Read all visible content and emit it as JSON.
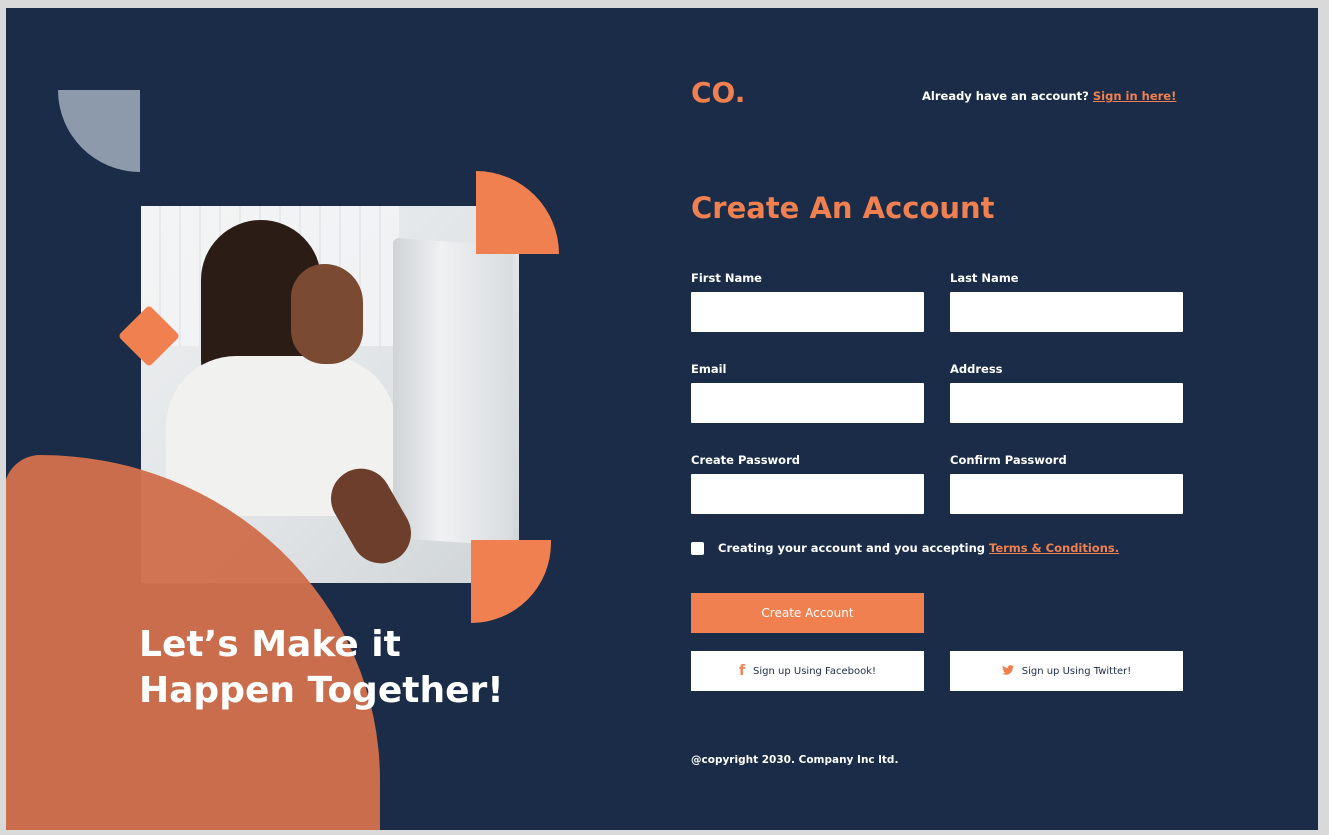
{
  "brand": {
    "logo": "CO.",
    "accent_color": "#f08050",
    "background_color": "#1a2c48"
  },
  "header": {
    "signin_prompt": "Already have an account?",
    "signin_link": "Sign in here!"
  },
  "hero": {
    "tagline_line1": "Let’s Make it",
    "tagline_line2": "Happen Together!"
  },
  "form": {
    "title": "Create An Account",
    "fields": [
      {
        "label": "First Name",
        "value": ""
      },
      {
        "label": "Last Name",
        "value": ""
      },
      {
        "label": "Email",
        "value": ""
      },
      {
        "label": "Address",
        "value": ""
      },
      {
        "label": "Create Password",
        "value": ""
      },
      {
        "label": "Confirm Password",
        "value": ""
      }
    ],
    "terms_text": "Creating your account and you accepting",
    "terms_link": "Terms & Conditions.",
    "submit_label": "Create Account",
    "facebook_label": "Sign up Using Facebook!",
    "facebook_icon": "facebook-icon",
    "twitter_label": "Sign up Using Twitter!",
    "twitter_icon": "twitter-icon"
  },
  "footer": {
    "copyright": "@copyright 2030. Company Inc ltd."
  }
}
